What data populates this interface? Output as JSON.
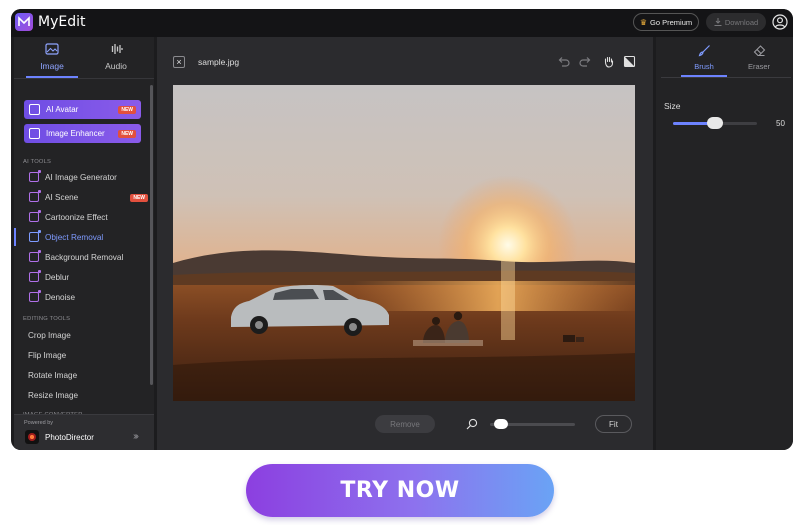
{
  "app": {
    "title": "MyEdit"
  },
  "header": {
    "premium_label": "Go Premium",
    "download_label": "Download"
  },
  "sidebar": {
    "tabs": [
      {
        "label": "Image",
        "active": true
      },
      {
        "label": "Audio",
        "active": false
      }
    ],
    "promos": [
      {
        "label": "AI Avatar",
        "badge": "NEW"
      },
      {
        "label": "Image Enhancer",
        "badge": "NEW"
      }
    ],
    "ai_tools_label": "AI TOOLS",
    "ai_tools": [
      {
        "label": "AI Image Generator"
      },
      {
        "label": "AI Scene",
        "badge": "NEW"
      },
      {
        "label": "Cartoonize Effect"
      },
      {
        "label": "Object Removal",
        "active": true
      },
      {
        "label": "Background Removal"
      },
      {
        "label": "Deblur"
      },
      {
        "label": "Denoise"
      }
    ],
    "editing_tools_label": "EDITING TOOLS",
    "editing_tools": [
      "Crop Image",
      "Flip Image",
      "Rotate Image",
      "Resize Image"
    ],
    "image_converter_label": "IMAGE CONVERTER",
    "footer": {
      "powered_by": "Powered by",
      "product": "PhotoDirector"
    }
  },
  "workspace": {
    "file_name": "sample.jpg",
    "remove_label": "Remove",
    "fit_label": "Fit",
    "zoom_level": 0.05
  },
  "right_panel": {
    "tabs": [
      {
        "label": "Brush",
        "active": true
      },
      {
        "label": "Eraser",
        "active": false
      }
    ],
    "size_label": "Size",
    "size_value": "50",
    "size_fraction": 0.5
  },
  "cta": {
    "label": "TRY NOW"
  },
  "colors": {
    "accent": "#6d83ff",
    "brand_purple": "#8a5bea",
    "badge_red": "#e2503e",
    "background": "#1c1c1e"
  }
}
